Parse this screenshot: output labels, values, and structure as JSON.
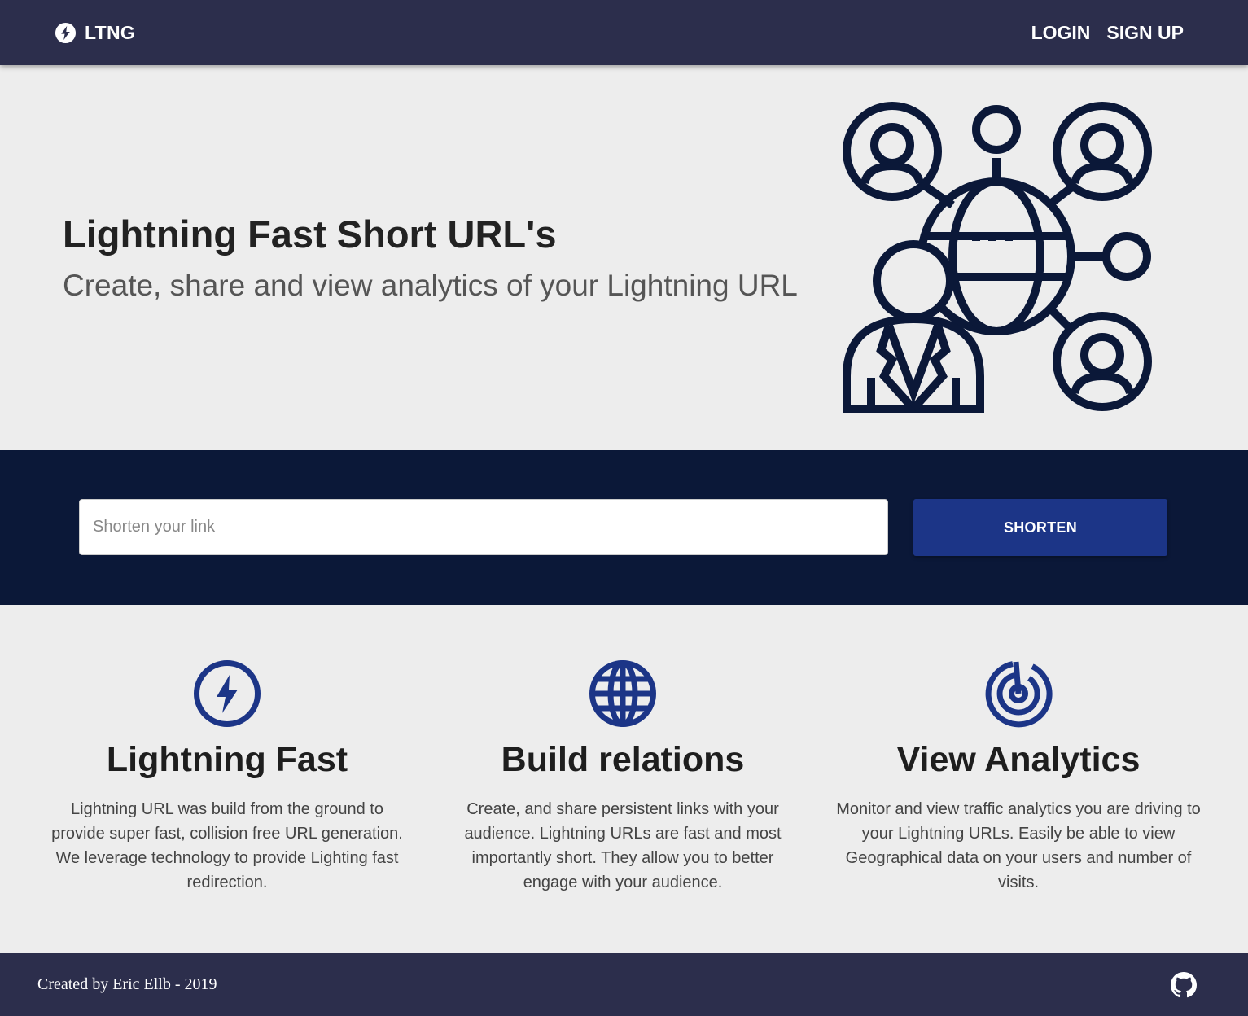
{
  "navbar": {
    "brand": "LTNG",
    "brand_icon": "lightning-bolt-icon",
    "links": [
      "LOGIN",
      "SIGN UP"
    ]
  },
  "hero": {
    "title": "Lightning Fast Short URL's",
    "subtitle": "Create, share and view analytics of your Lightning URL",
    "illustration": "global-network-people-icon"
  },
  "shorten": {
    "placeholder": "Shorten your link",
    "value": "",
    "button_label": "SHORTEN"
  },
  "features": [
    {
      "icon": "lightning-bolt-icon",
      "title": "Lightning Fast",
      "description": "Lightning URL was build from the ground to provide super fast, collision free URL generation. We leverage technology to provide Lighting fast redirection."
    },
    {
      "icon": "globe-icon",
      "title": "Build relations",
      "description": "Create, and share persistent links with your audience. Lightning URLs are fast and most importantly short. They allow you to better engage with your audience."
    },
    {
      "icon": "radar-icon",
      "title": "View Analytics",
      "description": "Monitor and view traffic analytics you are driving to your Lightning URLs. Easily be able to view Geographical data on your users and number of visits."
    }
  ],
  "footer": {
    "credit": "Created by Eric Ellb - 2019",
    "social_icon": "github-icon"
  },
  "colors": {
    "navbar": "#2c2e4c",
    "band": "#0b1838",
    "accent": "#1c3587",
    "illustration": "#0b1838",
    "background": "#ededed"
  }
}
